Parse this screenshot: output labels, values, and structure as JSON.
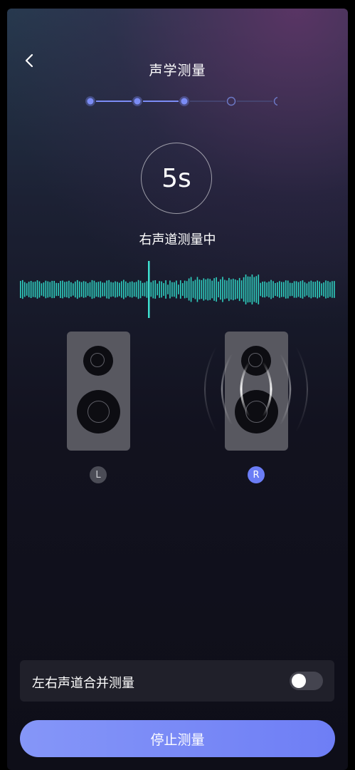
{
  "header": {
    "title": "声学测量",
    "back_icon": "chevron-left-icon"
  },
  "stepper": {
    "total_steps": 5,
    "completed_steps": 3,
    "active_color": "#7b8cf5",
    "inactive_color": "#6c78c4"
  },
  "timer": {
    "value": "5s"
  },
  "status": {
    "text": "右声道测量中"
  },
  "waveform": {
    "color": "#2fcfc0",
    "playhead_color": "#3ee0d0"
  },
  "speakers": {
    "left": {
      "badge": "L",
      "active": false
    },
    "right": {
      "badge": "R",
      "active": true
    }
  },
  "merge": {
    "label": "左右声道合并测量",
    "enabled": false
  },
  "actions": {
    "stop_label": "停止测量",
    "accent": "#7282f6"
  }
}
